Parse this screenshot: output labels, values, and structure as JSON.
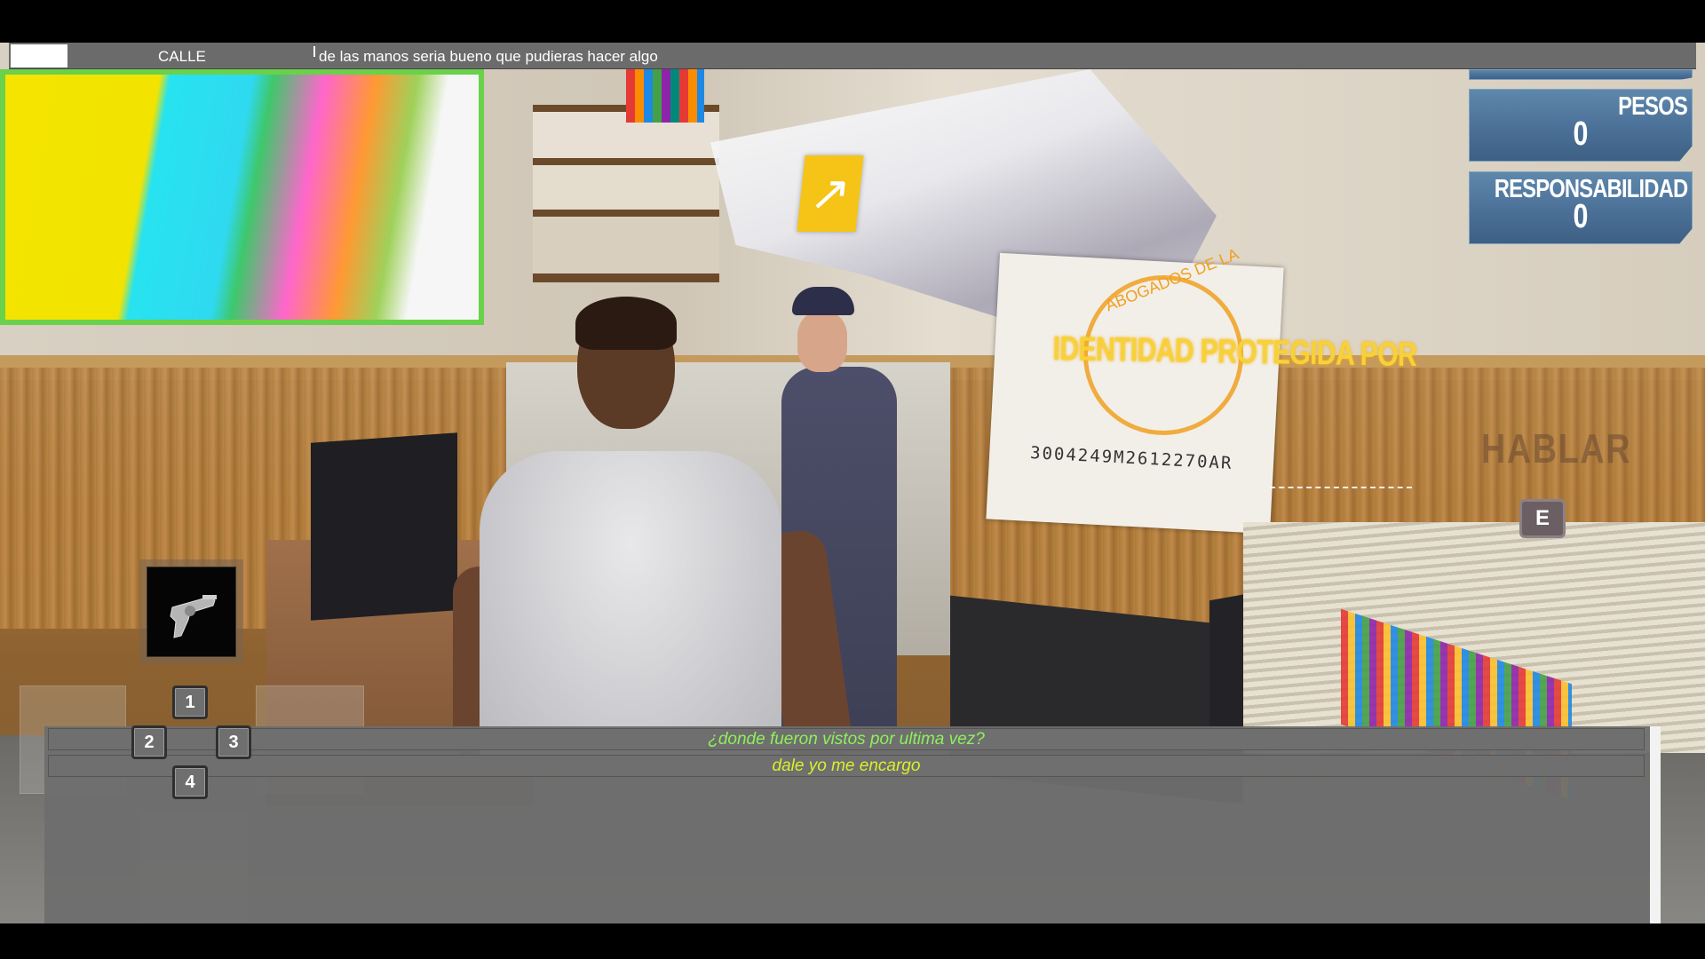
{
  "topbar": {
    "zone": "CALLE",
    "message": "de las manos seria bueno que pudieras hacer algo"
  },
  "stats": {
    "pesos_label": "PESOS",
    "pesos_value": "0",
    "responsabilidad_label": "RESPONSABILIDAD",
    "responsabilidad_value": "0"
  },
  "scene": {
    "id_overlay": "IDENTIDAD PROTEGIDA POR",
    "id_seal_text": "ABOGADOS DE LA",
    "id_number": "3004249M2612270AR",
    "prompt_label": "HABLAR",
    "prompt_key": "E",
    "waypoint_icon": "arrow-up-right-icon"
  },
  "inventory": {
    "slot_item": "revolver-icon"
  },
  "hotkeys": [
    "1",
    "2",
    "3",
    "4"
  ],
  "dialog": {
    "options": [
      "¿donde fueron vistos por ultima vez?",
      "dale yo me encargo"
    ]
  },
  "colors": {
    "stat_panel": "#4b7097",
    "waypoint": "#f5c417",
    "option_green": "#8ef05a",
    "option_yellow": "#d9f02a",
    "overlay_text": "#f6d23a"
  }
}
